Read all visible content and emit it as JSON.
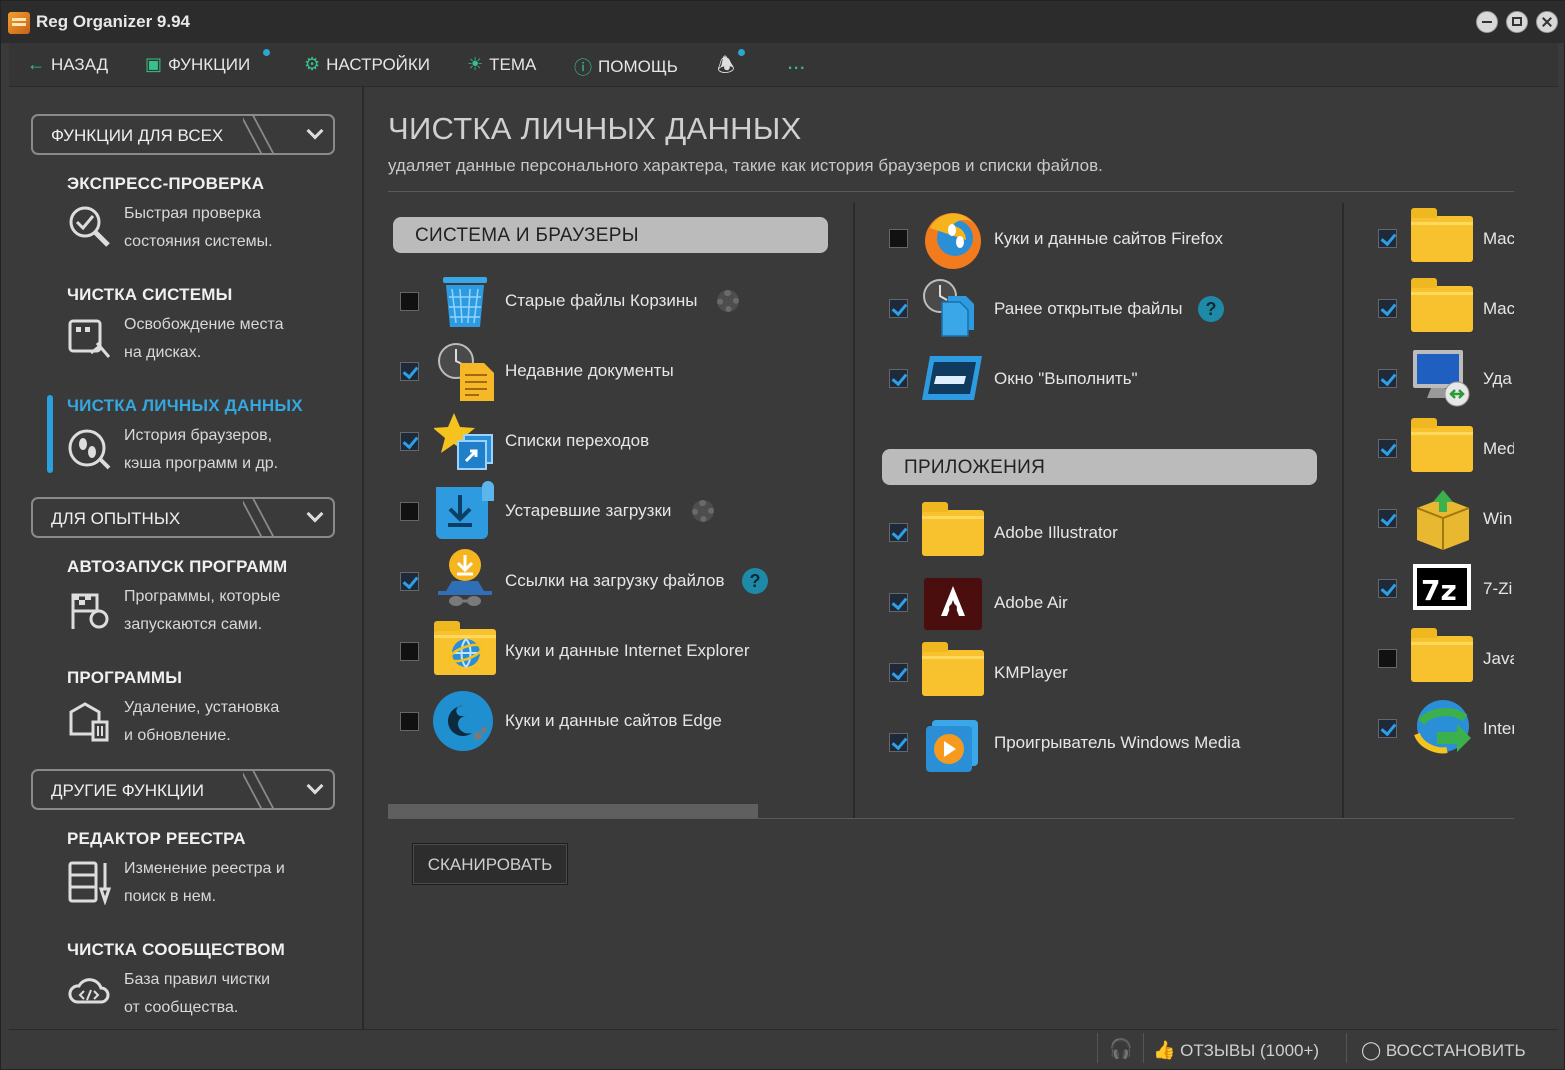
{
  "window": {
    "title": "Reg Organizer 9.94"
  },
  "menu": {
    "back": "НАЗАД",
    "functions": "ФУНКЦИИ",
    "settings": "НАСТРОЙКИ",
    "theme": "ТЕМА",
    "help": "ПОМОЩЬ",
    "more": "..."
  },
  "sidebar": {
    "cat1": "ФУНКЦИИ ДЛЯ ВСЕХ",
    "cat2": "ДЛЯ ОПЫТНЫХ",
    "cat3": "ДРУГИЕ ФУНКЦИИ",
    "items": [
      {
        "title": "ЭКСПРЕСС-ПРОВЕРКА",
        "l1": "Быстрая проверка",
        "l2": "состояния системы."
      },
      {
        "title": "ЧИСТКА СИСТЕМЫ",
        "l1": "Освобождение места",
        "l2": "на дисках."
      },
      {
        "title": "ЧИСТКА ЛИЧНЫХ ДАННЫХ",
        "l1": "История браузеров,",
        "l2": "кэша программ и др."
      },
      {
        "title": "АВТОЗАПУСК ПРОГРАММ",
        "l1": "Программы, которые",
        "l2": "запускаются сами."
      },
      {
        "title": "ПРОГРАММЫ",
        "l1": "Удаление, установка",
        "l2": "и обновление."
      },
      {
        "title": "РЕДАКТОР РЕЕСТРА",
        "l1": "Изменение реестра и",
        "l2": "поиск в нем."
      },
      {
        "title": "ЧИСТКА СООБЩЕСТВОМ",
        "l1": "База правил чистки",
        "l2": "от сообщества."
      }
    ]
  },
  "main": {
    "title": "ЧИСТКА ЛИЧНЫХ ДАННЫХ",
    "subtitle": "удаляет данные персонального характера, такие как история браузеров и списки файлов.",
    "section_system": "СИСТЕМА И БРАУЗЕРЫ",
    "section_apps": "ПРИЛОЖЕНИЯ",
    "col1": [
      {
        "label": "Старые файлы Корзины",
        "checked": false
      },
      {
        "label": "Недавние документы",
        "checked": true
      },
      {
        "label": "Списки переходов",
        "checked": true
      },
      {
        "label": "Устаревшие загрузки",
        "checked": false
      },
      {
        "label": "Ссылки на загрузку файлов",
        "checked": true
      },
      {
        "label": "Куки и данные Internet Explorer",
        "checked": false
      },
      {
        "label": "Куки и данные сайтов Edge",
        "checked": false
      }
    ],
    "col2_top": [
      {
        "label": "Куки и данные сайтов Firefox",
        "checked": false
      },
      {
        "label": "Ранее открытые файлы",
        "checked": true
      },
      {
        "label": "Окно \"Выполнить\"",
        "checked": true
      }
    ],
    "col2_apps": [
      {
        "label": "Adobe Illustrator",
        "checked": true
      },
      {
        "label": "Adobe Air",
        "checked": true
      },
      {
        "label": "KMPlayer",
        "checked": true
      },
      {
        "label": "Проигрыватель Windows Media",
        "checked": true
      }
    ],
    "col3": [
      {
        "label": "Mac",
        "checked": true
      },
      {
        "label": "Mac",
        "checked": true
      },
      {
        "label": "Уда",
        "checked": true
      },
      {
        "label": "Med",
        "checked": true
      },
      {
        "label": "Win",
        "checked": true
      },
      {
        "label": "7-Zi",
        "checked": true
      },
      {
        "label": "Java",
        "checked": false
      },
      {
        "label": "Inter",
        "checked": true
      }
    ],
    "scan_button": "СКАНИРОВАТЬ",
    "help_glyph": "?"
  },
  "status": {
    "reviews": "ОТЗЫВЫ (1000+)",
    "restore": "ВОССТАНОВИТЬ"
  }
}
